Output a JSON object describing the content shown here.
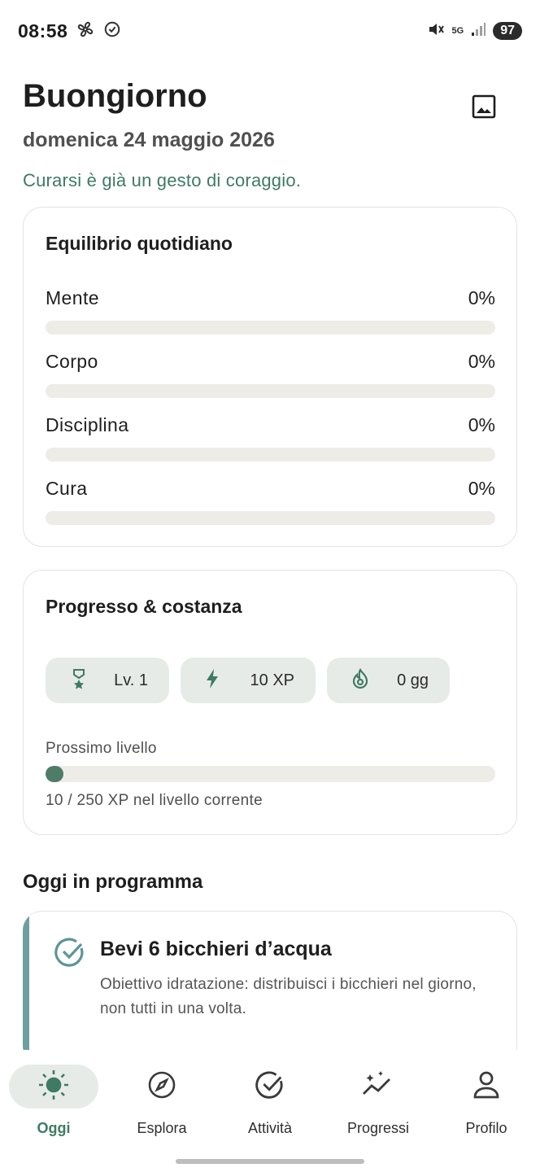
{
  "status_bar": {
    "time": "08:58",
    "battery": "97",
    "network": "5G"
  },
  "header": {
    "greeting": "Buongiorno",
    "date": "domenica 24 maggio 2026",
    "motto": "Curarsi è già un gesto di coraggio."
  },
  "balance": {
    "title": "Equilibrio quotidiano",
    "metrics": [
      {
        "label": "Mente",
        "value": "0%",
        "fraction": 0
      },
      {
        "label": "Corpo",
        "value": "0%",
        "fraction": 0
      },
      {
        "label": "Disciplina",
        "value": "0%",
        "fraction": 0
      },
      {
        "label": "Cura",
        "value": "0%",
        "fraction": 0
      }
    ]
  },
  "progress": {
    "title": "Progresso & costanza",
    "chips": {
      "level": "Lv. 1",
      "xp": "10 XP",
      "streak": "0 gg"
    },
    "next_label": "Prossimo livello",
    "next_fraction": 0.04,
    "next_caption": "10 / 250 XP nel livello corrente"
  },
  "today": {
    "title": "Oggi in programma",
    "tasks": [
      {
        "title": "Bevi 6 bicchieri d’acqua",
        "description": "Obiettivo idratazione: distribuisci i bicchieri nel giorno, non tutti in una volta."
      }
    ]
  },
  "nav": {
    "items": [
      {
        "label": "Oggi",
        "icon": "sun-icon",
        "active": true
      },
      {
        "label": "Esplora",
        "icon": "compass-icon",
        "active": false
      },
      {
        "label": "Attività",
        "icon": "check-circle-icon",
        "active": false
      },
      {
        "label": "Progressi",
        "icon": "trend-icon",
        "active": false
      },
      {
        "label": "Profilo",
        "icon": "person-icon",
        "active": false
      }
    ]
  },
  "colors": {
    "accent": "#3f7a64",
    "bar_fill": "#4d7c68",
    "track": "#eeece6",
    "task_accent": "#6f9ea0"
  }
}
